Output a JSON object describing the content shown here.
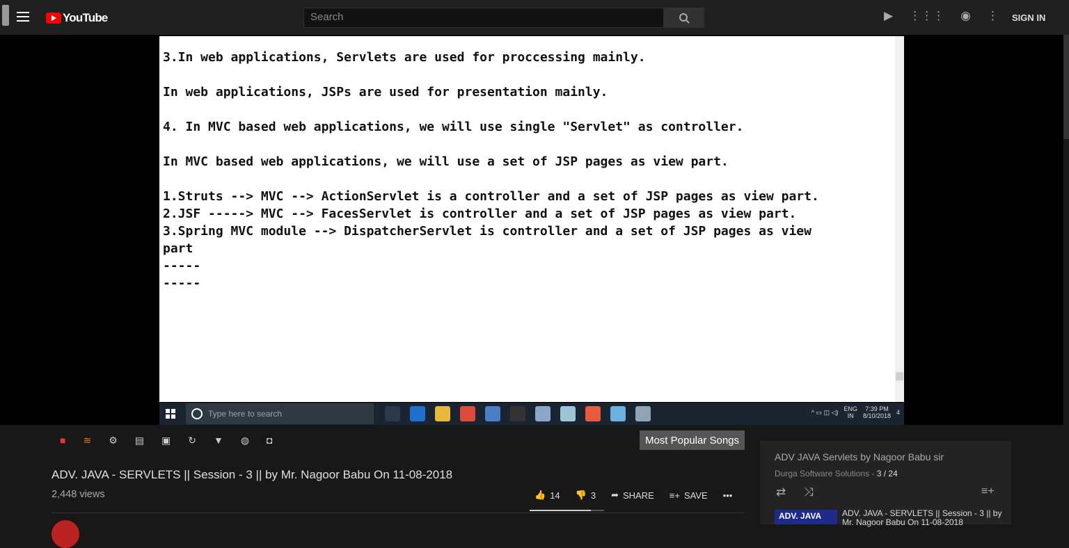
{
  "header": {
    "logo_text": "YouTube",
    "search_placeholder": "Search",
    "sign_in": "SIGN IN"
  },
  "video_screen": {
    "lines": [
      "3.In web applications, Servlets are used for proccessing mainly.",
      "",
      "In web applications, JSPs are used for presentation mainly.",
      "",
      "4. In MVC based web applications, we will use single \"Servlet\" as controller.",
      "",
      "In MVC based web applications, we will use a set of JSP pages as view part.",
      "",
      "1.Struts --> MVC --> ActionServlet is a controller and a set of JSP pages as view part.",
      "2.JSF -----> MVC --> FacesServlet is controller and a set of JSP pages as view part.",
      "3.Spring MVC module --> DispatcherServlet is controller and a set of JSP pages as view",
      "part",
      "-----",
      "-----"
    ],
    "taskbar": {
      "search_placeholder": "Type here to search",
      "lang": "ENG",
      "region": "IN",
      "time": "7:39 PM",
      "date": "8/10/2018",
      "notifications": "4"
    }
  },
  "below_player": {
    "most_popular": "Most Popular Songs",
    "title": "ADV. JAVA - SERVLETS || Session - 3 || by Mr. Nagoor Babu On 11-08-2018",
    "views": "2,448 views",
    "likes": "14",
    "dislikes": "3",
    "share": "SHARE",
    "save": "SAVE",
    "like_ratio": 0.82
  },
  "playlist": {
    "title": "ADV JAVA Servlets by Nagoor Babu sir",
    "channel": "Durga Software Solutions - ",
    "position": "3 / 24",
    "thumb_text": "ADV. JAVA",
    "item_title": "ADV. JAVA - SERVLETS || Session - 3 || by Mr. Nagoor Babu On 11-08-2018"
  }
}
